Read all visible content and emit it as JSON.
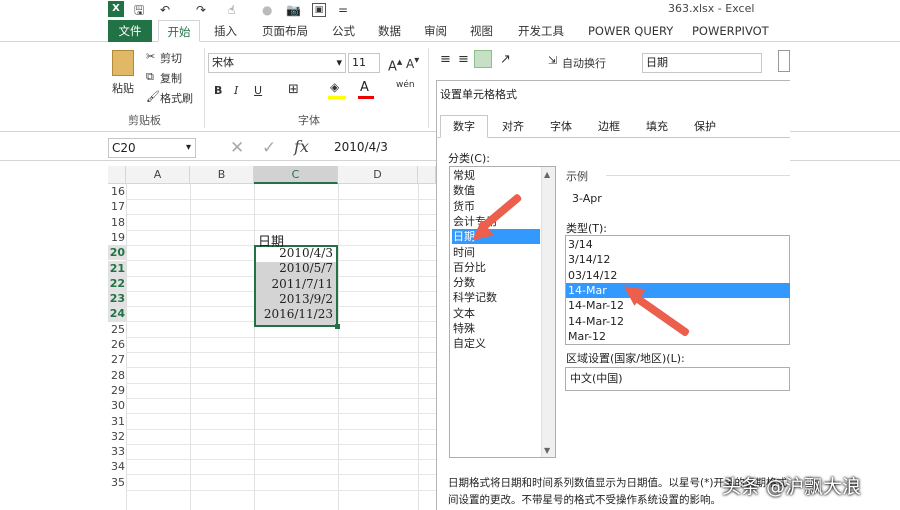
{
  "titlebar": {
    "file_name": "363.xlsx - Excel",
    "qa_save": "🖫",
    "qa_undo": "↶",
    "qa_redo": "↷",
    "qa_touch": "☝",
    "qa_camera": "📷",
    "qa_more": "="
  },
  "tabs": [
    "文件",
    "开始",
    "插入",
    "页面布局",
    "公式",
    "数据",
    "审阅",
    "视图",
    "开发工具",
    "POWER QUERY",
    "POWERPIVOT"
  ],
  "ribbon": {
    "paste": "粘贴",
    "cut": "剪切",
    "copy": "复制",
    "format_painter": "格式刷",
    "clipboard_group": "剪贴板",
    "font_name": "宋体",
    "font_size": "11",
    "font_group": "字体",
    "wrap_text": "自动换行",
    "number_format": "日期",
    "bold": "B",
    "italic": "I",
    "underline": "U",
    "wen": "wén"
  },
  "formula": {
    "name_box": "C20",
    "value": "2010/4/3",
    "fx": "fx"
  },
  "sheet": {
    "columns": [
      "A",
      "B",
      "C",
      "D"
    ],
    "rows": [
      "16",
      "17",
      "18",
      "19",
      "20",
      "21",
      "22",
      "23",
      "24",
      "25",
      "26",
      "27",
      "28",
      "29",
      "30",
      "31",
      "32",
      "33",
      "34",
      "35"
    ],
    "header_text": "日期",
    "dates": [
      "2010/4/3",
      "2010/5/7",
      "2011/7/11",
      "2013/9/2",
      "2016/11/23"
    ]
  },
  "dialog": {
    "title": "设置单元格格式",
    "tabs": [
      "数字",
      "对齐",
      "字体",
      "边框",
      "填充",
      "保护"
    ],
    "category_label": "分类(C):",
    "categories": [
      "常规",
      "数值",
      "货币",
      "会计专用",
      "日期",
      "时间",
      "百分比",
      "分数",
      "科学记数",
      "文本",
      "特殊",
      "自定义"
    ],
    "sample_label": "示例",
    "sample_value": "3-Apr",
    "type_label": "类型(T):",
    "types": [
      "3/14",
      "3/14/12",
      "03/14/12",
      "14-Mar",
      "14-Mar-12",
      "14-Mar-12",
      "Mar-12"
    ],
    "locale_label": "区域设置(国家/地区)(L):",
    "locale_value": "中文(中国)",
    "description_line1": "日期格式将日期和时间系列数值显示为日期值。以星号(*)开头的日期格式响应操作系统特定的区域日期和时",
    "description_line2": "间设置的更改。不带星号的格式不受操作系统设置的影响。"
  },
  "watermark": "头条 @沪飘大浪",
  "colors": {
    "excel_green": "#217346",
    "selection_blue": "#3399ff",
    "arrow_red": "#ec5f4c"
  }
}
